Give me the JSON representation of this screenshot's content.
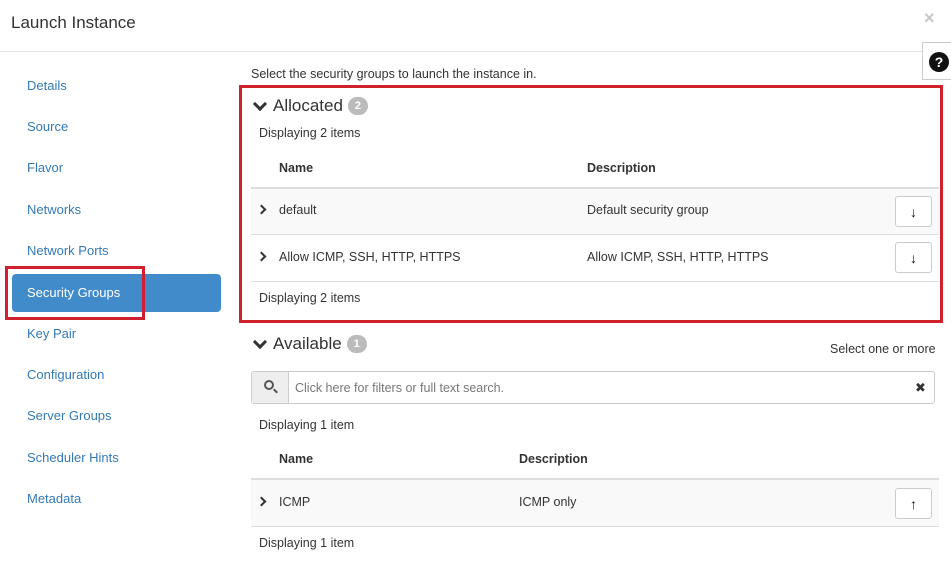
{
  "modal": {
    "title": "Launch Instance",
    "close_icon": "×",
    "help_icon": "?"
  },
  "sidebar": {
    "items": [
      {
        "label": "Details"
      },
      {
        "label": "Source"
      },
      {
        "label": "Flavor"
      },
      {
        "label": "Networks"
      },
      {
        "label": "Network Ports"
      },
      {
        "label": "Security Groups",
        "active": true
      },
      {
        "label": "Key Pair"
      },
      {
        "label": "Configuration"
      },
      {
        "label": "Server Groups"
      },
      {
        "label": "Scheduler Hints"
      },
      {
        "label": "Metadata"
      }
    ]
  },
  "main": {
    "intro": "Select the security groups to launch the instance in.",
    "allocated": {
      "heading": "Allocated",
      "count": "2",
      "displaying_top": "Displaying 2 items",
      "displaying_bottom": "Displaying 2 items",
      "columns": [
        "Name",
        "Description"
      ],
      "rows": [
        {
          "name": "default",
          "description": "Default security group"
        },
        {
          "name": "Allow ICMP, SSH, HTTP, HTTPS",
          "description": "Allow ICMP, SSH, HTTP, HTTPS"
        }
      ]
    },
    "available": {
      "heading": "Available",
      "count": "1",
      "select_hint": "Select one or more",
      "search_placeholder": "Click here for filters or full text search.",
      "displaying_top": "Displaying 1 item",
      "displaying_bottom": "Displaying 1 item",
      "columns": [
        "Name",
        "Description"
      ],
      "rows": [
        {
          "name": "ICMP",
          "description": "ICMP only"
        }
      ]
    }
  },
  "colors": {
    "accent": "#428bca",
    "link": "#337ab7",
    "highlight_box": "#d0202e",
    "badge": "#bbbbbb"
  },
  "icons": {
    "close": "close-icon",
    "help": "help-icon",
    "search": "search-icon",
    "clear": "clear-icon",
    "expand": "chevron-right-icon",
    "section_toggle": "chevron-down-icon",
    "deallocate": "arrow-down-icon",
    "allocate": "arrow-up-icon"
  }
}
